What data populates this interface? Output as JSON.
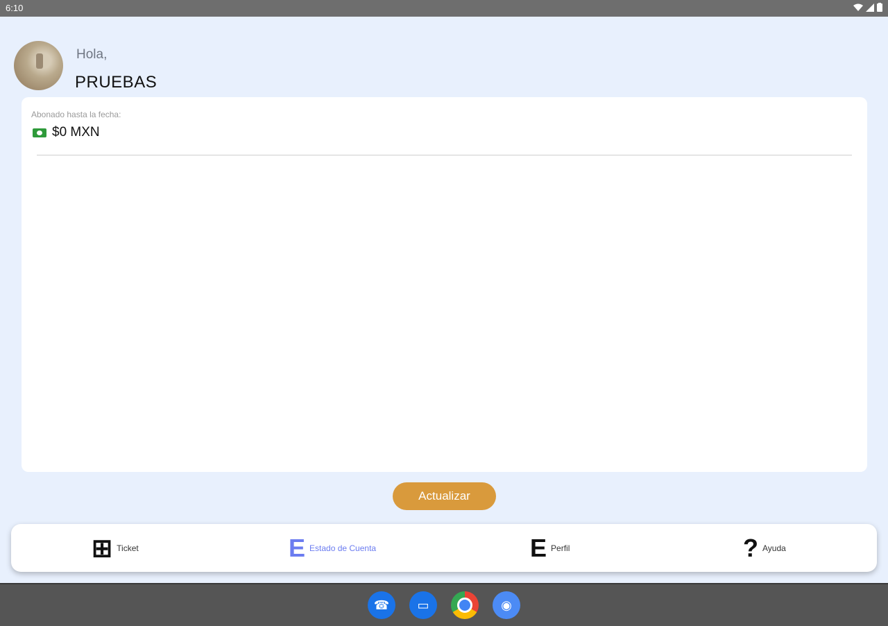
{
  "status_bar": {
    "time": "6:10",
    "wifi_icon": "wifi-icon",
    "signal_icon": "signal-icon",
    "battery_icon": "battery-icon"
  },
  "header": {
    "greeting": "Hola,",
    "username": "PRUEBAS"
  },
  "balance_card": {
    "label": "Abonado hasta la fecha:",
    "amount": "$0 MXN",
    "icon": "cash-icon",
    "icon_color": "#2e9a3a"
  },
  "actions": {
    "refresh_label": "Actualizar",
    "refresh_color": "#d99a3c"
  },
  "nav": {
    "items": [
      {
        "label": "Ticket",
        "icon": "add-ticket-icon",
        "active": false
      },
      {
        "label": "Estado de Cuenta",
        "icon": "account-statement-icon",
        "active": true
      },
      {
        "label": "Perfil",
        "icon": "profile-icon",
        "active": false
      },
      {
        "label": "Ayuda",
        "icon": "help-icon",
        "active": false
      }
    ],
    "active_color": "#6b7cf0"
  },
  "dock": [
    "phone-icon",
    "messages-icon",
    "chrome-icon",
    "camera-icon"
  ]
}
